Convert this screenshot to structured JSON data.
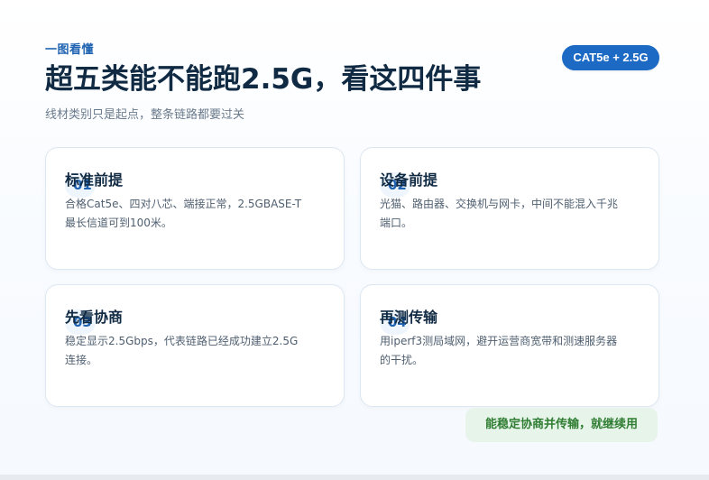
{
  "header": {
    "kicker": "一图看懂",
    "title": "超五类能不能跑2.5G，看这四件事",
    "subtitle": "线材类别只是起点，整条链路都要过关",
    "badge": "CAT5e + 2.5G"
  },
  "cards": [
    {
      "number": "01",
      "title": "标准前提",
      "text": "合格Cat5e、四对八芯、端接正常，2.5GBASE-T最长信道可到100米。"
    },
    {
      "number": "02",
      "title": "设备前提",
      "text": "光猫、路由器、交换机与网卡，中间不能混入千兆端口。"
    },
    {
      "number": "03",
      "title": "先看协商",
      "text": "稳定显示2.5Gbps，代表链路已经成功建立2.5G连接。"
    },
    {
      "number": "04",
      "title": "再测传输",
      "text": "用iperf3测局域网，避开运营商宽带和测速服务器的干扰。"
    }
  ],
  "footer": {
    "note": "能稳定协商并传输，就继续用"
  }
}
